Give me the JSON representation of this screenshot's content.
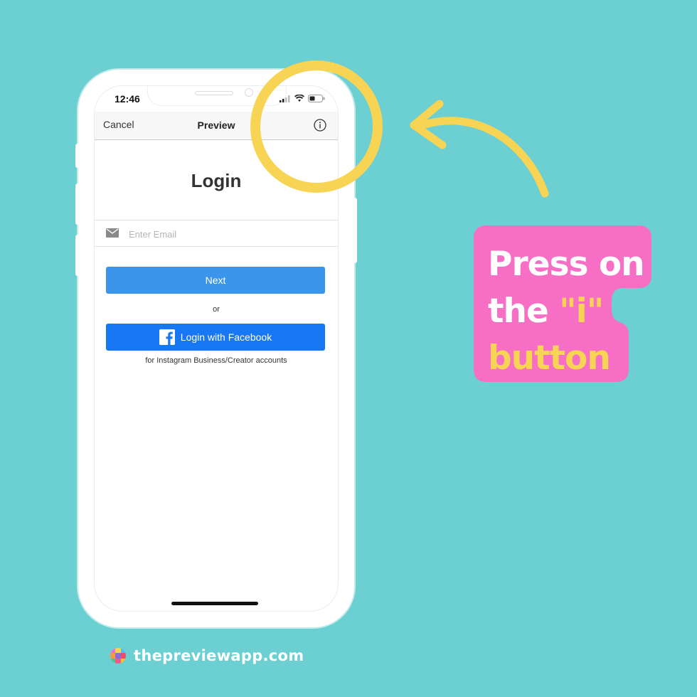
{
  "status_bar": {
    "time": "12:46"
  },
  "navbar": {
    "cancel_label": "Cancel",
    "title": "Preview",
    "info_icon": "info-icon"
  },
  "login": {
    "title": "Login",
    "email_placeholder": "Enter Email",
    "next_label": "Next",
    "or_text": "or",
    "facebook_label": "Login with Facebook",
    "facebook_note": "for Instagram Business/Creator accounts"
  },
  "callout": {
    "line1": "Press on",
    "line2_prefix": "the ",
    "line2_highlight": "\"i\"",
    "line3": "button"
  },
  "footer": {
    "site": "thepreviewapp.com"
  },
  "colors": {
    "background": "#6CCFD2",
    "highlight_yellow": "#F7D453",
    "callout_pink": "#F66FC4",
    "next_blue": "#3b95ea",
    "facebook_blue": "#1877f2"
  }
}
